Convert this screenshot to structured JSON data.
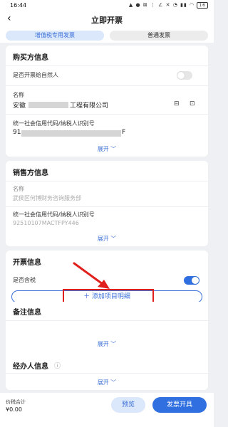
{
  "status": {
    "time": "16:44",
    "icons": "▲ ● ⊠ ⋮ ∠ ✕ ◔ ▮▮ ◠",
    "battery": "16"
  },
  "header": {
    "back_icon": "chevron-left",
    "title": "立即开票"
  },
  "tabs": [
    {
      "label": "增值税专用发票",
      "active": true
    },
    {
      "label": "普通发票",
      "active": false
    }
  ],
  "buyer": {
    "title": "购买方信息",
    "natural_person_label": "是否开票给自然人",
    "natural_person_enabled": false,
    "name_label": "名称",
    "name_prefix": "安徽",
    "name_suffix": "工程有限公司",
    "tax_id_label": "统一社会信用代码/纳税人识别号",
    "tax_id_prefix": "91",
    "tax_id_suffix": "F",
    "expand_label": "展开 ﹀"
  },
  "seller": {
    "title": "销售方信息",
    "name_label": "名称",
    "name_value": "武侯区何博财务咨询服务部",
    "tax_id_label": "统一社会信用代码/纳税人识别号",
    "tax_id_value": "92510107MACTFPY446",
    "expand_label": "展开 ﹀"
  },
  "invoice": {
    "title": "开票信息",
    "tax_included_label": "是否含税",
    "tax_included_enabled": true,
    "add_item_label": "＋ 添加项目明细"
  },
  "remarks": {
    "title": "备注信息",
    "expand_label": "展开 ﹀"
  },
  "agent": {
    "title": "经办人信息",
    "info_icon": "ⓘ",
    "expand_label": "展开 ﹀"
  },
  "bottom": {
    "total_label": "价税合计",
    "total_value": "¥0.00",
    "preview_label": "预览",
    "issue_label": "发票开具"
  },
  "colors": {
    "accent": "#2f6fe0",
    "highlight": "#e0201c"
  }
}
